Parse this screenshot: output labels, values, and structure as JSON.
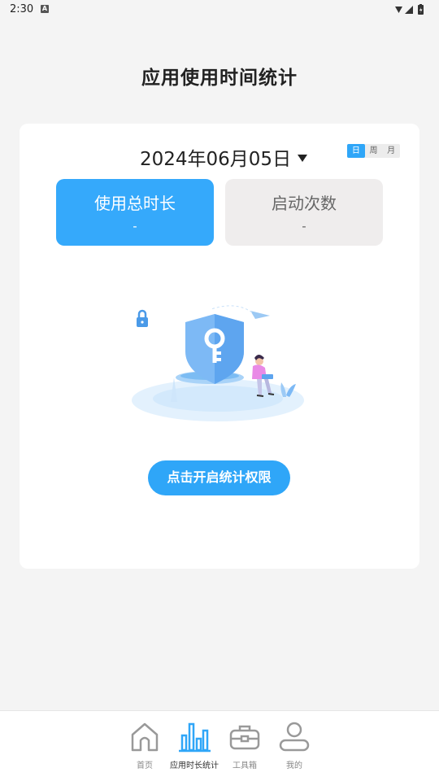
{
  "status_bar": {
    "time": "2:30",
    "badge": "A"
  },
  "title": "应用使用时间统计",
  "date": {
    "label": "2024年06月05日"
  },
  "period_tabs": [
    {
      "label": "日",
      "active": true
    },
    {
      "label": "周",
      "active": false
    },
    {
      "label": "月",
      "active": false
    }
  ],
  "stats": {
    "total_duration": {
      "label": "使用总时长",
      "value": "-"
    },
    "launch_count": {
      "label": "启动次数",
      "value": "-"
    }
  },
  "permission_button": {
    "label": "点击开启统计权限"
  },
  "colors": {
    "accent": "#2fa6f8",
    "background": "#f4f4f4",
    "card": "#ffffff"
  },
  "bottom_nav": [
    {
      "label": "首页",
      "icon": "home-icon",
      "active": false
    },
    {
      "label": "应用时长统计",
      "icon": "bar-chart-icon",
      "active": true
    },
    {
      "label": "工具箱",
      "icon": "toolbox-icon",
      "active": false
    },
    {
      "label": "我的",
      "icon": "user-icon",
      "active": false
    }
  ]
}
